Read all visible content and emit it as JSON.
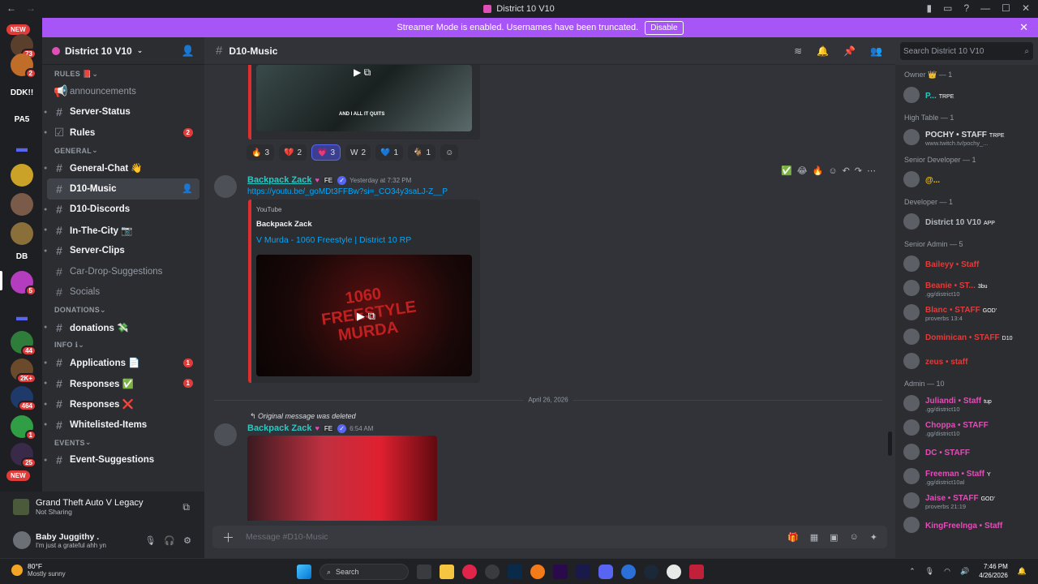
{
  "window": {
    "title": "District 10 V10",
    "controls": [
      "—",
      "☐",
      "✕"
    ]
  },
  "streamer_banner": {
    "text": "Streamer Mode is enabled. Usernames have been truncated.",
    "button": "Disable"
  },
  "server_rail": {
    "new_badge_top": "NEW",
    "new_badge_bottom": "NEW",
    "items": [
      {
        "label": "",
        "badge": "73",
        "color": "#5a3f2c"
      },
      {
        "label": "",
        "badge": "2",
        "color": "#c06d2a"
      },
      {
        "label": "DDK!!",
        "badge": "",
        "color": "#1e1f22"
      },
      {
        "label": "PA5",
        "badge": "",
        "color": "#1e1f22"
      },
      {
        "label": "▬",
        "badge": "",
        "color": "#1e1f22"
      },
      {
        "label": "",
        "badge": "",
        "color": "#c9a227"
      },
      {
        "label": "",
        "badge": "",
        "color": "#7a5a48"
      },
      {
        "label": "",
        "badge": "",
        "color": "#8a6f3a"
      },
      {
        "label": "DB",
        "badge": "",
        "color": "#1e1f22"
      },
      {
        "label": "",
        "badge": "5",
        "color": "#b43cbf"
      },
      {
        "label": "▬",
        "badge": "",
        "color": "#1e1f22"
      },
      {
        "label": "",
        "badge": "44",
        "color": "#2f7d3a"
      },
      {
        "label": "",
        "badge": "2K+",
        "color": "#6a4a2a"
      },
      {
        "label": "",
        "badge": "464",
        "color": "#1d3a6a"
      },
      {
        "label": "",
        "badge": "1",
        "color": "#2f9e44"
      },
      {
        "label": "",
        "badge": "25",
        "color": "#3a2a4a"
      }
    ]
  },
  "guild": {
    "name": "District 10 V10"
  },
  "channels": [
    {
      "kind": "cat",
      "label": "RULES 📕"
    },
    {
      "kind": "ch",
      "label": "announcements",
      "icon": "📢",
      "bold": false
    },
    {
      "kind": "ch",
      "label": "Server-Status",
      "icon": "#",
      "bold": true
    },
    {
      "kind": "ch",
      "label": "Rules",
      "icon": "☑",
      "bold": true,
      "count": "2"
    },
    {
      "kind": "cat",
      "label": "GENERAL"
    },
    {
      "kind": "ch",
      "label": "General-Chat 👋",
      "icon": "#",
      "bold": true
    },
    {
      "kind": "ch",
      "label": "D10-Music",
      "icon": "#",
      "bold": true,
      "active": true
    },
    {
      "kind": "ch",
      "label": "D10-Discords",
      "icon": "#",
      "bold": true
    },
    {
      "kind": "ch",
      "label": "In-The-City 📷",
      "icon": "#",
      "bold": true
    },
    {
      "kind": "ch",
      "label": "Server-Clips",
      "icon": "#",
      "bold": true
    },
    {
      "kind": "ch",
      "label": "Car-Drop-Suggestions",
      "icon": "#",
      "bold": false
    },
    {
      "kind": "ch",
      "label": "Socials",
      "icon": "#",
      "bold": false
    },
    {
      "kind": "cat",
      "label": "DONATIONS"
    },
    {
      "kind": "ch",
      "label": "donations 💸",
      "icon": "#",
      "bold": true
    },
    {
      "kind": "cat",
      "label": "INFO ℹ"
    },
    {
      "kind": "ch",
      "label": "Applications 📄",
      "icon": "#",
      "bold": true,
      "count": "1"
    },
    {
      "kind": "ch",
      "label": "Responses ✅",
      "icon": "#",
      "bold": true,
      "count": "1"
    },
    {
      "kind": "ch",
      "label": "Responses ❌",
      "icon": "#",
      "bold": true
    },
    {
      "kind": "ch",
      "label": "Whitelisted-Items",
      "icon": "#",
      "bold": true
    },
    {
      "kind": "cat",
      "label": "EVENTS"
    },
    {
      "kind": "ch",
      "label": "Event-Suggestions",
      "icon": "#",
      "bold": true
    }
  ],
  "activity": {
    "game": "Grand Theft Auto V Legacy",
    "status": "Not Sharing"
  },
  "user": {
    "name": "Baby Juggithy .",
    "status": "I'm just a grateful ahh yn"
  },
  "channel_header": {
    "name": "D10-Music"
  },
  "search": {
    "placeholder": "Search District 10 V10"
  },
  "messages": {
    "reactions": [
      {
        "emoji": "🔥",
        "count": "3"
      },
      {
        "emoji": "💔",
        "count": "2"
      },
      {
        "emoji": "💗",
        "count": "3",
        "me": true
      },
      {
        "emoji": "W",
        "count": "2"
      },
      {
        "emoji": "💙",
        "count": "1"
      },
      {
        "emoji": "🐐",
        "count": "1"
      },
      {
        "emoji": "☺",
        "count": ""
      }
    ],
    "first_thumb_caption": "AND I ALL IT QUITS",
    "msg1": {
      "author": "Backpack Zack",
      "tag": "FE",
      "timestamp": "Yesterday at 7:32 PM",
      "link": "https://youtu.be/_goMDt3FFBw?si=_CO34y3saLJ-Z__P",
      "embed_provider": "YouTube",
      "embed_author": "Backpack Zack",
      "embed_title": "V Murda - 1060 Freestyle | District 10 RP",
      "thumb_text": "1060 FREESTYLE MURDA"
    },
    "date_divider": "April 26, 2026",
    "msg2": {
      "reply_note": "Original message was deleted",
      "author": "Backpack Zack",
      "tag": "FE",
      "timestamp": "6:54 AM"
    },
    "hover_actions": [
      "✅",
      "😂",
      "🔥",
      "☺",
      "↶",
      "↷",
      "⋯"
    ]
  },
  "composer": {
    "placeholder": "Message #D10-Music"
  },
  "members": [
    {
      "group": "Owner 👑 — 1"
    },
    {
      "name": "P...",
      "color": "#2dc7c2",
      "tag": "TRPE"
    },
    {
      "group": "High Table — 1"
    },
    {
      "name": "POCHY • STAFF",
      "color": "#dbdee1",
      "tag": "TRPE",
      "sub": "www.twitch.tv/pochy_..."
    },
    {
      "group": "Senior Developer — 1"
    },
    {
      "name": "@...",
      "color": "#f0c419",
      "tag": ""
    },
    {
      "group": "Developer — 1"
    },
    {
      "name": "District 10 V10",
      "color": "#b5bac1",
      "tag": "APP"
    },
    {
      "group": "Senior Admin — 5"
    },
    {
      "name": "Baileyy • Staff",
      "color": "#e03c3c",
      "tag": ""
    },
    {
      "name": "Beanie • ST...",
      "color": "#e03c3c",
      "tag": "3bu",
      "sub": ".gg/district10"
    },
    {
      "name": "Blanc • STAFF",
      "color": "#e03c3c",
      "tag": "GOD'",
      "sub": "proverbs 13:4"
    },
    {
      "name": "Dominican • STAFF",
      "color": "#e03c3c",
      "tag": "D10"
    },
    {
      "name": "zeus • staff",
      "color": "#e03c3c",
      "tag": ""
    },
    {
      "group": "Admin — 10"
    },
    {
      "name": "Juliandi • Staff",
      "color": "#e04fb6",
      "tag": "tup",
      "sub": ".gg/district10"
    },
    {
      "name": "Choppa • STAFF",
      "color": "#e04fb6",
      "tag": "",
      "sub": ".gg/district10"
    },
    {
      "name": "DC • STAFF",
      "color": "#e04fb6",
      "tag": ""
    },
    {
      "name": "Freeman • Staff",
      "color": "#e04fb6",
      "tag": "Y",
      "sub": ".gg/district10al"
    },
    {
      "name": "Jaise • STAFF",
      "color": "#e04fb6",
      "tag": "GOD'",
      "sub": "proverbs 21:19"
    },
    {
      "name": "KingFreelnga • Staff",
      "color": "#e04fb6",
      "tag": ""
    }
  ],
  "taskbar": {
    "weather_temp": "80°F",
    "weather_desc": "Mostly sunny",
    "search": "Search",
    "time": "7:46 PM",
    "date": "4/26/2026"
  }
}
